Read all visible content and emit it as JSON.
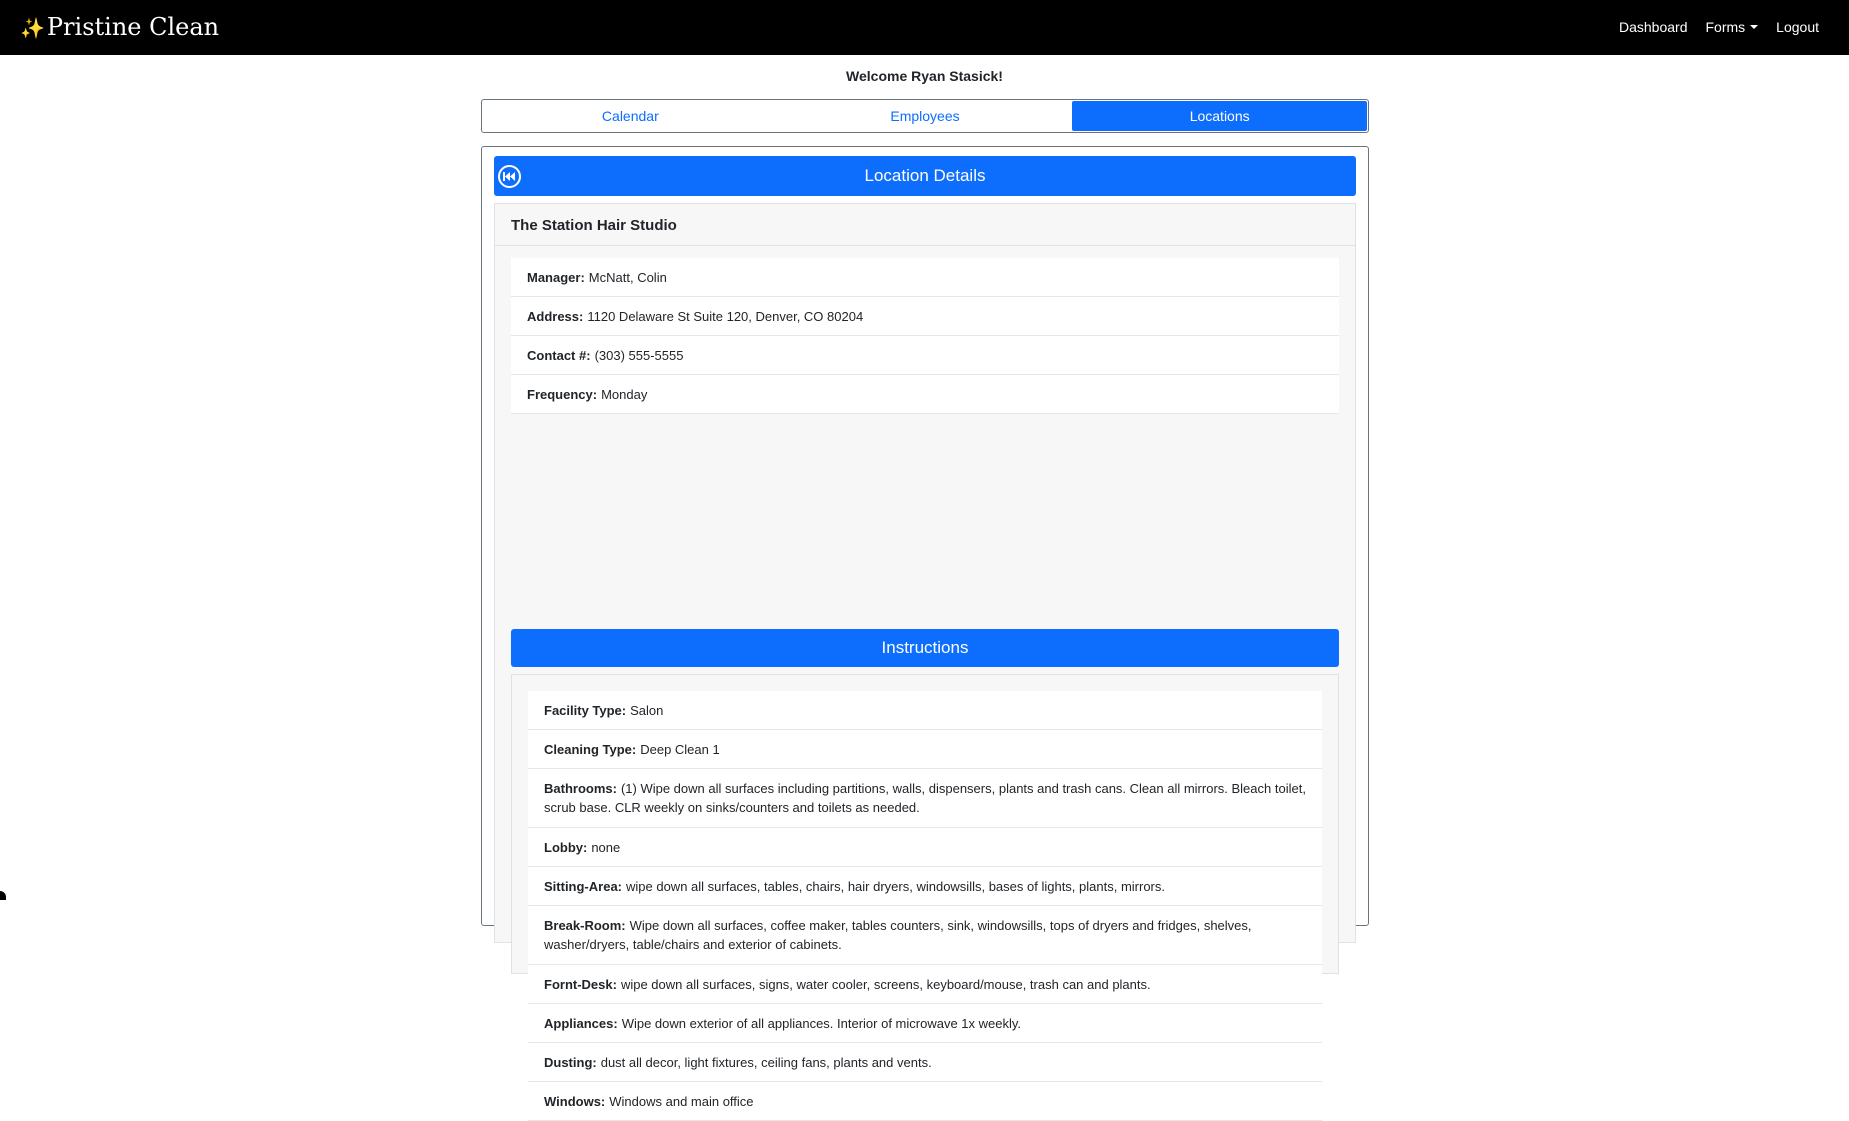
{
  "app": {
    "brand_icon": "✨",
    "brand_text": "Pristine Clean"
  },
  "nav": {
    "dashboard": "Dashboard",
    "forms": "Forms",
    "logout": "Logout"
  },
  "welcome": "Welcome Ryan Stasick!",
  "tabs": {
    "calendar": "Calendar",
    "employees": "Employees",
    "locations": "Locations"
  },
  "details": {
    "title": "Location Details",
    "location_name": "The Station Hair Studio",
    "fields": [
      {
        "label": "Manager:",
        "value": "McNatt, Colin"
      },
      {
        "label": "Address:",
        "value": "1120 Delaware St Suite 120, Denver, CO 80204"
      },
      {
        "label": "Contact #:",
        "value": "(303) 555-5555"
      },
      {
        "label": "Frequency:",
        "value": "Monday"
      }
    ]
  },
  "instructions": {
    "title": "Instructions",
    "items": [
      {
        "label": "Facility Type:",
        "value": "Salon"
      },
      {
        "label": "Cleaning Type:",
        "value": "Deep Clean 1"
      },
      {
        "label": "Bathrooms:",
        "value": "(1) Wipe down all surfaces including partitions, walls, dispensers, plants and trash cans. Clean all mirrors. Bleach toilet, scrub base. CLR weekly on sinks/counters and toilets as needed."
      },
      {
        "label": "Lobby:",
        "value": "none"
      },
      {
        "label": "Sitting-Area:",
        "value": "wipe down all surfaces, tables, chairs, hair dryers, windowsills, bases of lights, plants, mirrors."
      },
      {
        "label": "Break-Room:",
        "value": "Wipe down all surfaces, coffee maker, tables counters, sink, windowsills, tops of dryers and fridges, shelves, washer/dryers, table/chairs and exterior of cabinets."
      },
      {
        "label": "Fornt-Desk:",
        "value": "wipe down all surfaces, signs, water cooler, screens, keyboard/mouse, trash can and plants."
      },
      {
        "label": "Appliances:",
        "value": "Wipe down exterior of all appliances. Interior of microwave 1x weekly."
      },
      {
        "label": "Dusting:",
        "value": "dust all decor, light fixtures, ceiling fans, plants and vents."
      },
      {
        "label": "Windows:",
        "value": "Windows and main office"
      }
    ]
  },
  "colors": {
    "primary": "#0d6efd",
    "navbar": "#000000"
  },
  "icons": {
    "back": "back-icon",
    "brand": "sparkles-icon"
  }
}
